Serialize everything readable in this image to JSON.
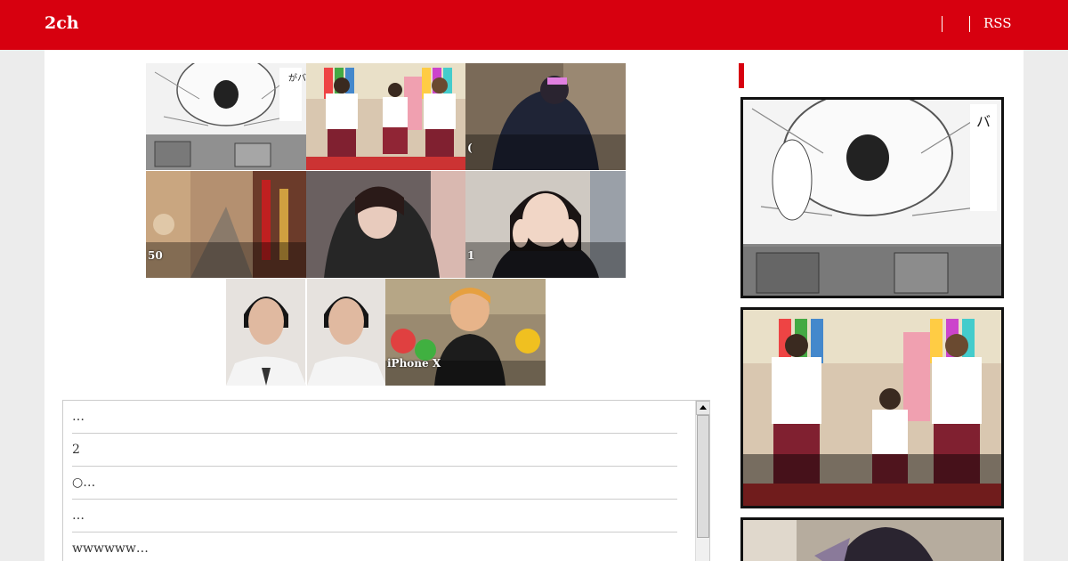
{
  "site": {
    "logo": "2ch",
    "nav": {
      "rss": "RSS"
    }
  },
  "grid": [
    {
      "caption": "",
      "scene": "manga"
    },
    {
      "caption": "",
      "scene": "tv-studio"
    },
    {
      "caption": "(",
      "scene": "photo-dark"
    },
    {
      "caption": "50",
      "scene": "city"
    },
    {
      "caption": "",
      "scene": "portrait"
    },
    {
      "caption": "1",
      "scene": "selfie"
    },
    {
      "caption": "",
      "scene": "faces"
    },
    {
      "caption": "iPhone X",
      "scene": "video"
    }
  ],
  "list": {
    "items": [
      "…",
      "2",
      "○…",
      "…",
      "wwwwww…"
    ]
  },
  "sidebar": {
    "thumbs": [
      {
        "scene": "manga"
      },
      {
        "scene": "tv-studio"
      },
      {
        "scene": "photo-dark"
      }
    ]
  },
  "colors": {
    "brand": "#d7000f"
  }
}
